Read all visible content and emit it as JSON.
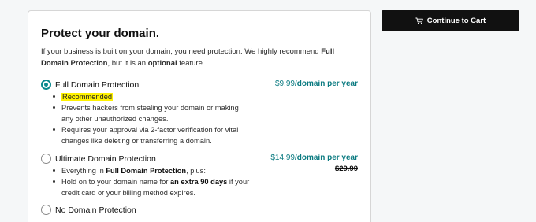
{
  "card": {
    "title": "Protect your domain.",
    "intro": {
      "part1": "If your business is built on your domain, you need protection. We highly recommend ",
      "bold1": "Full Domain Protection",
      "part2": ", but it is an ",
      "bold2": "optional",
      "part3": " feature."
    },
    "options": [
      {
        "name": "Full Domain Protection",
        "selected": true,
        "price": "$9.99",
        "per": "/domain per year",
        "badge": "Recommended",
        "bullets": [
          "Prevents hackers from stealing your domain or making any other unauthorized changes.",
          "Requires your approval via 2-factor verification for vital changes like deleting or transferring a domain."
        ]
      },
      {
        "name": "Ultimate Domain Protection",
        "selected": false,
        "price": "$14.99",
        "per": "/domain per year",
        "strike_price": "$29.99",
        "bullet1": {
          "pre": "Everything in ",
          "bold": "Full Domain Protection",
          "post": ", plus:"
        },
        "bullet2": {
          "pre": "Hold on to your domain name for ",
          "bold": "an extra 90 days",
          "post": " if your credit card or your billing method expires."
        }
      },
      {
        "name": "No Domain Protection",
        "selected": false
      }
    ]
  },
  "cart_button": {
    "label": "Continue to Cart",
    "icon": "shopping-cart-icon"
  },
  "colors": {
    "accent": "#0a8a8f",
    "button_bg": "#111111",
    "highlight": "#fff200",
    "page_bg": "#f5f7f8"
  }
}
